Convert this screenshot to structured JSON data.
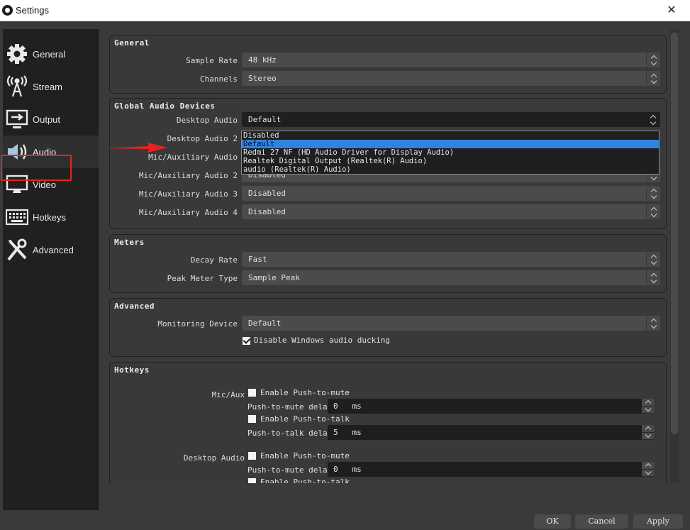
{
  "window": {
    "title": "Settings",
    "close_label": "✕"
  },
  "sidebar": {
    "items": [
      {
        "label": "General",
        "icon": "gear-icon"
      },
      {
        "label": "Stream",
        "icon": "broadcast-tower-icon"
      },
      {
        "label": "Output",
        "icon": "monitor-output-icon"
      },
      {
        "label": "Audio",
        "icon": "speaker-icon",
        "active": true
      },
      {
        "label": "Video",
        "icon": "monitor-icon"
      },
      {
        "label": "Hotkeys",
        "icon": "keyboard-icon"
      },
      {
        "label": "Advanced",
        "icon": "wrench-screwdriver-icon"
      }
    ]
  },
  "general": {
    "title": "General",
    "sample_rate": {
      "label": "Sample Rate",
      "value": "48 kHz"
    },
    "channels": {
      "label": "Channels",
      "value": "Stereo"
    }
  },
  "global_audio": {
    "title": "Global Audio Devices",
    "desktop_audio": {
      "label": "Desktop Audio",
      "value": "Default"
    },
    "desktop_audio_2": {
      "label": "Desktop Audio 2"
    },
    "mic_aux": {
      "label": "Mic/Auxiliary Audio"
    },
    "mic_aux_2": {
      "label": "Mic/Auxiliary Audio 2",
      "value": "Disabled"
    },
    "mic_aux_3": {
      "label": "Mic/Auxiliary Audio 3",
      "value": "Disabled"
    },
    "mic_aux_4": {
      "label": "Mic/Auxiliary Audio 4",
      "value": "Disabled"
    },
    "dropdown_options": [
      "Disabled",
      "Default",
      "Redmi 27 NF (HD Audio Driver for Display Audio)",
      "Realtek Digital Output (Realtek(R) Audio)",
      "audio (Realtek(R) Audio)"
    ],
    "dropdown_selected": "Default"
  },
  "meters": {
    "title": "Meters",
    "decay_rate": {
      "label": "Decay Rate",
      "value": "Fast"
    },
    "peak_meter_type": {
      "label": "Peak Meter Type",
      "value": "Sample Peak"
    }
  },
  "advanced": {
    "title": "Advanced",
    "monitoring_device": {
      "label": "Monitoring Device",
      "value": "Default"
    },
    "disable_ducking": {
      "label": "Disable Windows audio ducking",
      "checked": true
    }
  },
  "hotkeys": {
    "title": "Hotkeys",
    "mic_aux": {
      "label": "Mic/Aux",
      "push_to_mute": {
        "label": "Enable Push-to-mute",
        "checked": false
      },
      "push_to_mute_delay": {
        "label": "Push-to-mute delay",
        "value": "0",
        "unit": "ms"
      },
      "push_to_talk": {
        "label": "Enable Push-to-talk",
        "checked": false
      },
      "push_to_talk_delay": {
        "label": "Push-to-talk delay",
        "value": "5",
        "unit": "ms"
      }
    },
    "desktop_audio": {
      "label": "Desktop Audio",
      "push_to_mute": {
        "label": "Enable Push-to-mute",
        "checked": false
      },
      "push_to_mute_delay": {
        "label": "Push-to-mute delay",
        "value": "0",
        "unit": "ms"
      },
      "push_to_talk": {
        "label": "Enable Push-to-talk",
        "checked": false
      }
    }
  },
  "footer": {
    "ok": "OK",
    "cancel": "Cancel",
    "apply": "Apply"
  },
  "colors": {
    "accent": "#2e84de",
    "annotation": "#e8231f"
  }
}
